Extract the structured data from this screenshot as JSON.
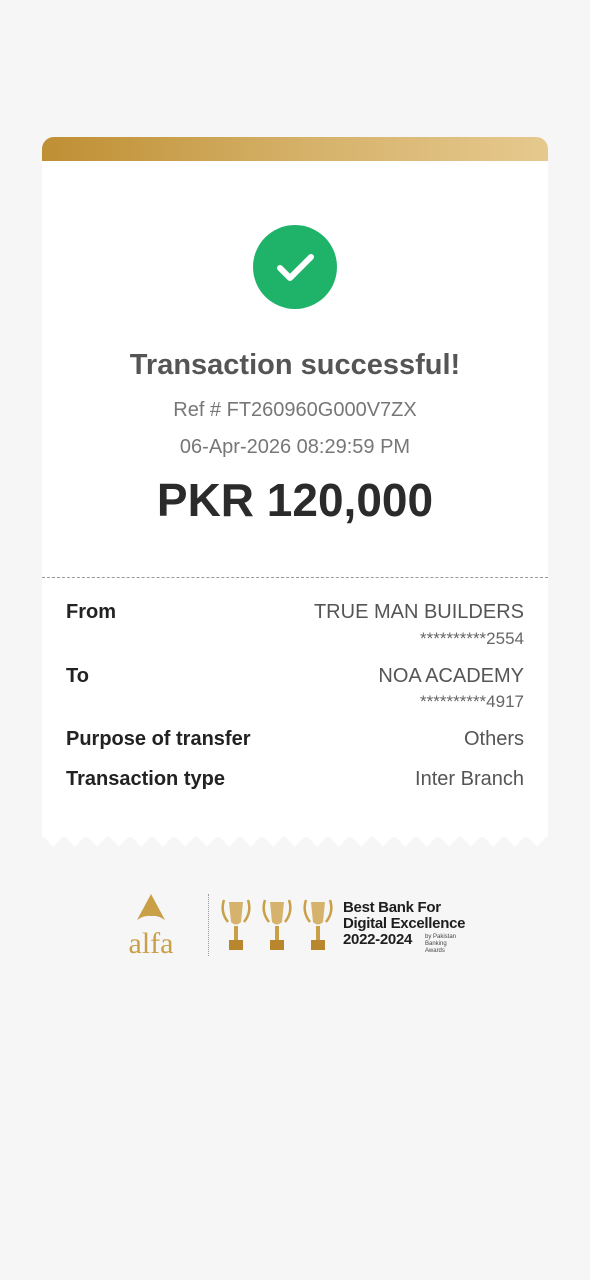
{
  "receipt": {
    "title": "Transaction successful!",
    "reference": "Ref # FT260960G000V7ZX",
    "datetime": "06-Apr-2026 08:29:59 PM",
    "amount": "PKR 120,000",
    "details": {
      "from": {
        "label": "From",
        "name": "TRUE MAN BUILDERS",
        "account": "**********2554"
      },
      "to": {
        "label": "To",
        "name": "NOA ACADEMY",
        "account": "**********4917"
      },
      "purpose": {
        "label": "Purpose of transfer",
        "value": "Others"
      },
      "type": {
        "label": "Transaction type",
        "value": "Inter Branch"
      }
    }
  },
  "footer": {
    "logo_text": "alfa",
    "award_line1": "Best Bank For",
    "award_line2": "Digital Excellence",
    "award_years": "2022-2024",
    "award_source_line1": "by Pakistan",
    "award_source_line2": "Banking Awards"
  },
  "colors": {
    "success": "#1fb36a",
    "gold": "#c9a048",
    "background": "#f6f6f6"
  },
  "icons": {
    "status": "checkmark-icon",
    "awards": "trophy-icon"
  }
}
